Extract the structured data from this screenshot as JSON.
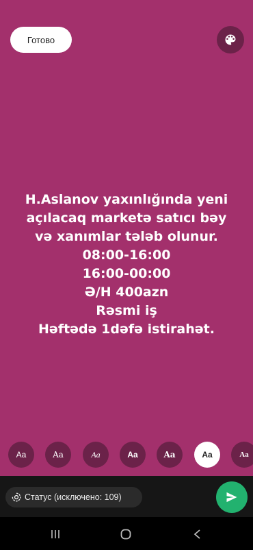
{
  "header": {
    "done_label": "Готово",
    "palette_icon": "palette-icon"
  },
  "status": {
    "background_color": "#a3306c",
    "lines": [
      "H.Aslanov yaxınlığında yeni",
      "açılacaq marketə satıcı bəy",
      "və xanımlar tələb olunur.",
      "08:00-16:00",
      "16:00-00:00",
      "Ə/H 400azn",
      "Rəsmi iş",
      "Həftədə 1dəfə istirahət."
    ]
  },
  "font_picker": {
    "options": [
      "Aa",
      "Aa",
      "Aa",
      "Aa",
      "Aa",
      "Aa",
      "Aa"
    ],
    "selected_index": 5
  },
  "footer": {
    "audience_label": "Статус (исключено: 109)",
    "audience_icon": "status-ring-icon",
    "send_icon": "send-icon",
    "send_color": "#22b26f"
  },
  "navigation": {
    "icons": [
      "recents-icon",
      "home-icon",
      "back-icon"
    ]
  }
}
